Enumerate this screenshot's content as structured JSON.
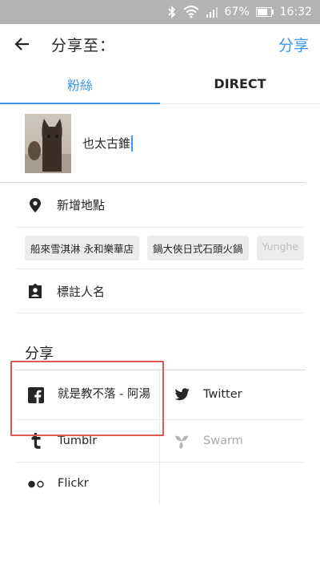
{
  "status_bar": {
    "battery": "67%",
    "time": "16:32"
  },
  "header": {
    "title": "分享至：",
    "share_action": "分享"
  },
  "tabs": [
    {
      "label": "粉絲",
      "active": true
    },
    {
      "label": "DIRECT",
      "active": false
    }
  ],
  "caption": {
    "text": "也太古錐"
  },
  "location": {
    "label": "新增地點",
    "suggestions": [
      "船來雪淇淋 永和樂華店",
      "鍋大俠日式石頭火鍋",
      "Yunghe"
    ]
  },
  "tag_people": {
    "label": "標註人名"
  },
  "share_section": {
    "title": "分享",
    "targets": [
      {
        "label": "就是教不落 - 阿湯",
        "icon": "facebook-icon",
        "enabled": true
      },
      {
        "label": "Twitter",
        "icon": "twitter-icon",
        "enabled": true
      },
      {
        "label": "Tumblr",
        "icon": "tumblr-icon",
        "enabled": true
      },
      {
        "label": "Swarm",
        "icon": "swarm-icon",
        "enabled": false
      },
      {
        "label": "Flickr",
        "icon": "flickr-icon",
        "enabled": true
      }
    ]
  },
  "colors": {
    "accent": "#3897f0",
    "highlight": "#e0584e",
    "status_bar": "#b3b3b3"
  }
}
